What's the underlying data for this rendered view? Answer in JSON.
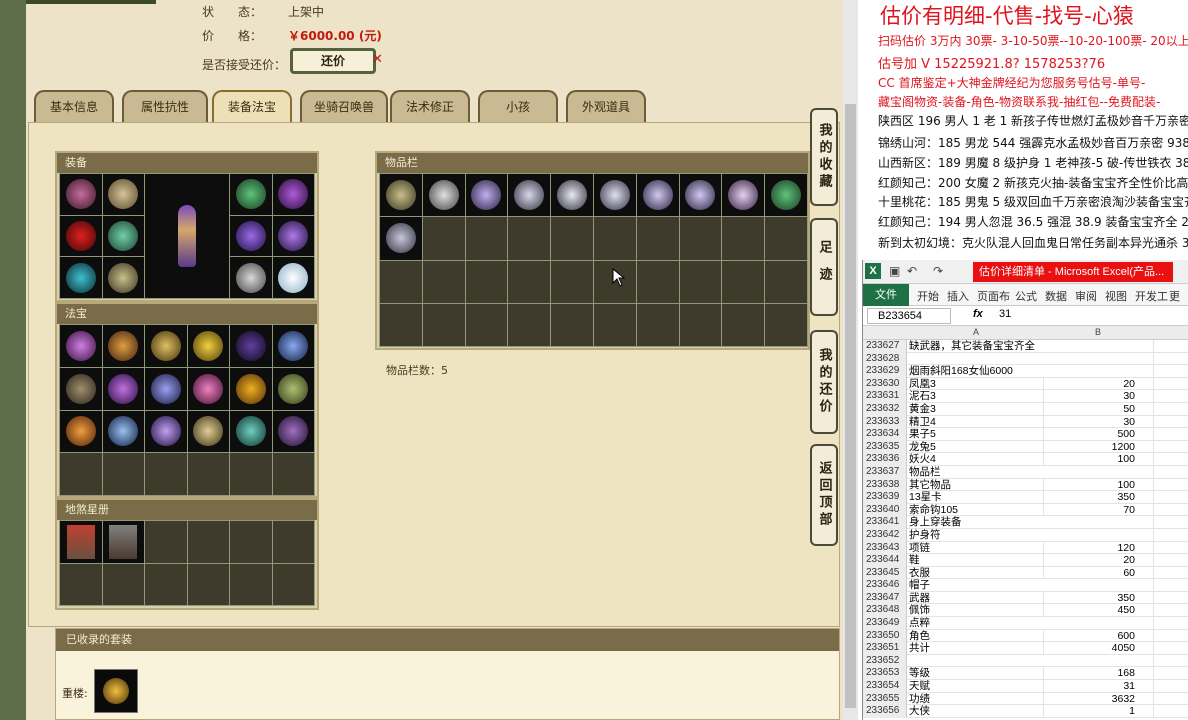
{
  "trade": {
    "status_label": "状　　态：",
    "status_value": "上架中",
    "price_label": "价　　格：",
    "price_value": "￥6000.00 (元)",
    "haggle_label": "是否接受还价：",
    "haggle_button": "还价"
  },
  "tabs": [
    "基本信息",
    "属性抗性",
    "装备法宝",
    "坐骑召唤兽",
    "法术修正",
    "小孩",
    "外观道具"
  ],
  "sections": {
    "equipment": "装备",
    "treasure": "法宝",
    "lingbao": "地煞星册",
    "inventory": "物品栏",
    "inventory_count": "物品栏数：5",
    "suits": "已收录的套装",
    "suit_name": "重楼:"
  },
  "side_buttons": [
    "我的收藏",
    "足迹",
    "我的还价",
    "返回顶部"
  ],
  "notes": {
    "headline": "估价有明细-代售-找号-心猿",
    "lines_red": [
      "扫码估价 3万内 30票- 3-10-50票--10-20-100票- 20以上 150+",
      "估号加 V 15225921.8?  1578253?76",
      "CC 首席鉴定+大神金牌经纪为您服务号估号-单号-",
      "藏宝阁物资-装备-角色-物资联系我-抽红包--免费配装-"
    ],
    "lines_black": [
      "陕西区 196 男人 1 老 1 新孩子传世燃灯孟极妙音千万亲密 4",
      "锦绣山河：185 男龙 544 强霹克水孟极妙音百万亲密 93888",
      "山西新区：189 男魔 8 级护身 1 老神孩-5 破-传世铁衣 38000",
      "红颜知己：200 女魔 2 新孩克火抽-装备宝宝齐全性价比高 215",
      "十里桃花：185 男鬼 5 级双回血千万亲密浪淘沙装备宝宝齐 8",
      "红颜知己：194 男人忽混 36.5 强混 38.9 装备宝宝齐全 28000",
      "新到太初幻境：克火队混人回血鬼日常任务副本异光通杀 31"
    ]
  },
  "excel": {
    "quick_undo": "↶",
    "quick_redo": "↷",
    "title": "估价详细清单 - Microsoft Excel(产品...",
    "file_tab": "文件",
    "ribbon_tabs": [
      "开始",
      "插入",
      "页面布",
      "公式",
      "数据",
      "审阅",
      "视图",
      "开发工",
      "更多"
    ],
    "name_box": "B233654",
    "fx": "fx",
    "formula_value": "31",
    "col_a": "A",
    "col_b": "B",
    "rows": [
      {
        "n": "233627",
        "a": "缺武器，其它装备宝宝齐全",
        "b": ""
      },
      {
        "n": "233628",
        "a": "",
        "b": ""
      },
      {
        "n": "233629",
        "a": "烟雨斜阳168女仙6000",
        "b": ""
      },
      {
        "n": "233630",
        "a": "凤凰3",
        "b": "20"
      },
      {
        "n": "233631",
        "a": "泥石3",
        "b": "30"
      },
      {
        "n": "233632",
        "a": "黄金3",
        "b": "50"
      },
      {
        "n": "233633",
        "a": "精卫4",
        "b": "30"
      },
      {
        "n": "233634",
        "a": "果子5",
        "b": "500"
      },
      {
        "n": "233635",
        "a": "龙兔5",
        "b": "1200"
      },
      {
        "n": "233636",
        "a": "妖火4",
        "b": "100"
      },
      {
        "n": "233637",
        "a": "物品栏",
        "b": ""
      },
      {
        "n": "233638",
        "a": "其它物品",
        "b": "100"
      },
      {
        "n": "233639",
        "a": "13星卡",
        "b": "350"
      },
      {
        "n": "233640",
        "a": "索命钩105",
        "b": "70"
      },
      {
        "n": "233641",
        "a": "身上穿装备",
        "b": ""
      },
      {
        "n": "233642",
        "a": "护身符",
        "b": ""
      },
      {
        "n": "233643",
        "a": "项链",
        "b": "120"
      },
      {
        "n": "233644",
        "a": "鞋",
        "b": "20"
      },
      {
        "n": "233645",
        "a": "衣服",
        "b": "60"
      },
      {
        "n": "233646",
        "a": "帽子",
        "b": ""
      },
      {
        "n": "233647",
        "a": "武器",
        "b": "350"
      },
      {
        "n": "233648",
        "a": "佩饰",
        "b": "450"
      },
      {
        "n": "233649",
        "a": "点粹",
        "b": ""
      },
      {
        "n": "233650",
        "a": "角色",
        "b": "600"
      },
      {
        "n": "233651",
        "a": "共计",
        "b": "4050"
      },
      {
        "n": "233652",
        "a": "",
        "b": ""
      },
      {
        "n": "233653",
        "a": "等级",
        "b": "168"
      },
      {
        "n": "233654",
        "a": "天赋",
        "b": "31"
      },
      {
        "n": "233655",
        "a": "功绩",
        "b": "3632"
      },
      {
        "n": "233656",
        "a": "大侠",
        "b": "1"
      }
    ]
  }
}
